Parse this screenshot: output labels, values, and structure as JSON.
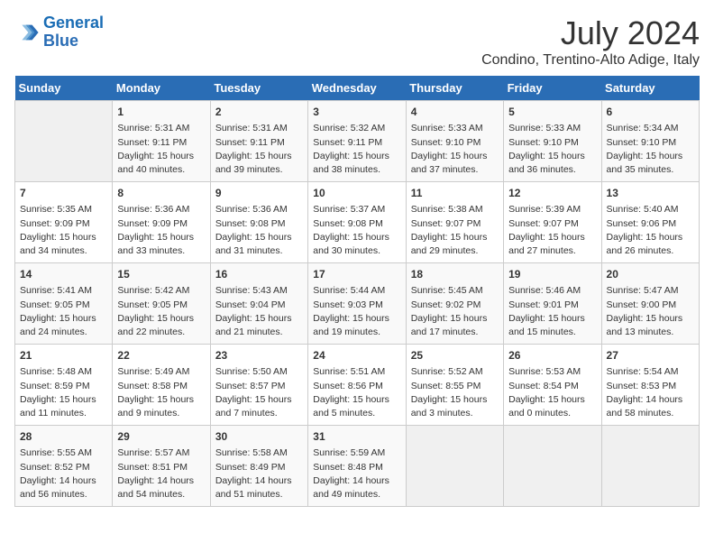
{
  "logo": {
    "line1": "General",
    "line2": "Blue"
  },
  "title": "July 2024",
  "subtitle": "Condino, Trentino-Alto Adige, Italy",
  "weekdays": [
    "Sunday",
    "Monday",
    "Tuesday",
    "Wednesday",
    "Thursday",
    "Friday",
    "Saturday"
  ],
  "weeks": [
    [
      {
        "day": "",
        "info": ""
      },
      {
        "day": "1",
        "info": "Sunrise: 5:31 AM\nSunset: 9:11 PM\nDaylight: 15 hours\nand 40 minutes."
      },
      {
        "day": "2",
        "info": "Sunrise: 5:31 AM\nSunset: 9:11 PM\nDaylight: 15 hours\nand 39 minutes."
      },
      {
        "day": "3",
        "info": "Sunrise: 5:32 AM\nSunset: 9:11 PM\nDaylight: 15 hours\nand 38 minutes."
      },
      {
        "day": "4",
        "info": "Sunrise: 5:33 AM\nSunset: 9:10 PM\nDaylight: 15 hours\nand 37 minutes."
      },
      {
        "day": "5",
        "info": "Sunrise: 5:33 AM\nSunset: 9:10 PM\nDaylight: 15 hours\nand 36 minutes."
      },
      {
        "day": "6",
        "info": "Sunrise: 5:34 AM\nSunset: 9:10 PM\nDaylight: 15 hours\nand 35 minutes."
      }
    ],
    [
      {
        "day": "7",
        "info": "Sunrise: 5:35 AM\nSunset: 9:09 PM\nDaylight: 15 hours\nand 34 minutes."
      },
      {
        "day": "8",
        "info": "Sunrise: 5:36 AM\nSunset: 9:09 PM\nDaylight: 15 hours\nand 33 minutes."
      },
      {
        "day": "9",
        "info": "Sunrise: 5:36 AM\nSunset: 9:08 PM\nDaylight: 15 hours\nand 31 minutes."
      },
      {
        "day": "10",
        "info": "Sunrise: 5:37 AM\nSunset: 9:08 PM\nDaylight: 15 hours\nand 30 minutes."
      },
      {
        "day": "11",
        "info": "Sunrise: 5:38 AM\nSunset: 9:07 PM\nDaylight: 15 hours\nand 29 minutes."
      },
      {
        "day": "12",
        "info": "Sunrise: 5:39 AM\nSunset: 9:07 PM\nDaylight: 15 hours\nand 27 minutes."
      },
      {
        "day": "13",
        "info": "Sunrise: 5:40 AM\nSunset: 9:06 PM\nDaylight: 15 hours\nand 26 minutes."
      }
    ],
    [
      {
        "day": "14",
        "info": "Sunrise: 5:41 AM\nSunset: 9:05 PM\nDaylight: 15 hours\nand 24 minutes."
      },
      {
        "day": "15",
        "info": "Sunrise: 5:42 AM\nSunset: 9:05 PM\nDaylight: 15 hours\nand 22 minutes."
      },
      {
        "day": "16",
        "info": "Sunrise: 5:43 AM\nSunset: 9:04 PM\nDaylight: 15 hours\nand 21 minutes."
      },
      {
        "day": "17",
        "info": "Sunrise: 5:44 AM\nSunset: 9:03 PM\nDaylight: 15 hours\nand 19 minutes."
      },
      {
        "day": "18",
        "info": "Sunrise: 5:45 AM\nSunset: 9:02 PM\nDaylight: 15 hours\nand 17 minutes."
      },
      {
        "day": "19",
        "info": "Sunrise: 5:46 AM\nSunset: 9:01 PM\nDaylight: 15 hours\nand 15 minutes."
      },
      {
        "day": "20",
        "info": "Sunrise: 5:47 AM\nSunset: 9:00 PM\nDaylight: 15 hours\nand 13 minutes."
      }
    ],
    [
      {
        "day": "21",
        "info": "Sunrise: 5:48 AM\nSunset: 8:59 PM\nDaylight: 15 hours\nand 11 minutes."
      },
      {
        "day": "22",
        "info": "Sunrise: 5:49 AM\nSunset: 8:58 PM\nDaylight: 15 hours\nand 9 minutes."
      },
      {
        "day": "23",
        "info": "Sunrise: 5:50 AM\nSunset: 8:57 PM\nDaylight: 15 hours\nand 7 minutes."
      },
      {
        "day": "24",
        "info": "Sunrise: 5:51 AM\nSunset: 8:56 PM\nDaylight: 15 hours\nand 5 minutes."
      },
      {
        "day": "25",
        "info": "Sunrise: 5:52 AM\nSunset: 8:55 PM\nDaylight: 15 hours\nand 3 minutes."
      },
      {
        "day": "26",
        "info": "Sunrise: 5:53 AM\nSunset: 8:54 PM\nDaylight: 15 hours\nand 0 minutes."
      },
      {
        "day": "27",
        "info": "Sunrise: 5:54 AM\nSunset: 8:53 PM\nDaylight: 14 hours\nand 58 minutes."
      }
    ],
    [
      {
        "day": "28",
        "info": "Sunrise: 5:55 AM\nSunset: 8:52 PM\nDaylight: 14 hours\nand 56 minutes."
      },
      {
        "day": "29",
        "info": "Sunrise: 5:57 AM\nSunset: 8:51 PM\nDaylight: 14 hours\nand 54 minutes."
      },
      {
        "day": "30",
        "info": "Sunrise: 5:58 AM\nSunset: 8:49 PM\nDaylight: 14 hours\nand 51 minutes."
      },
      {
        "day": "31",
        "info": "Sunrise: 5:59 AM\nSunset: 8:48 PM\nDaylight: 14 hours\nand 49 minutes."
      },
      {
        "day": "",
        "info": ""
      },
      {
        "day": "",
        "info": ""
      },
      {
        "day": "",
        "info": ""
      }
    ]
  ]
}
